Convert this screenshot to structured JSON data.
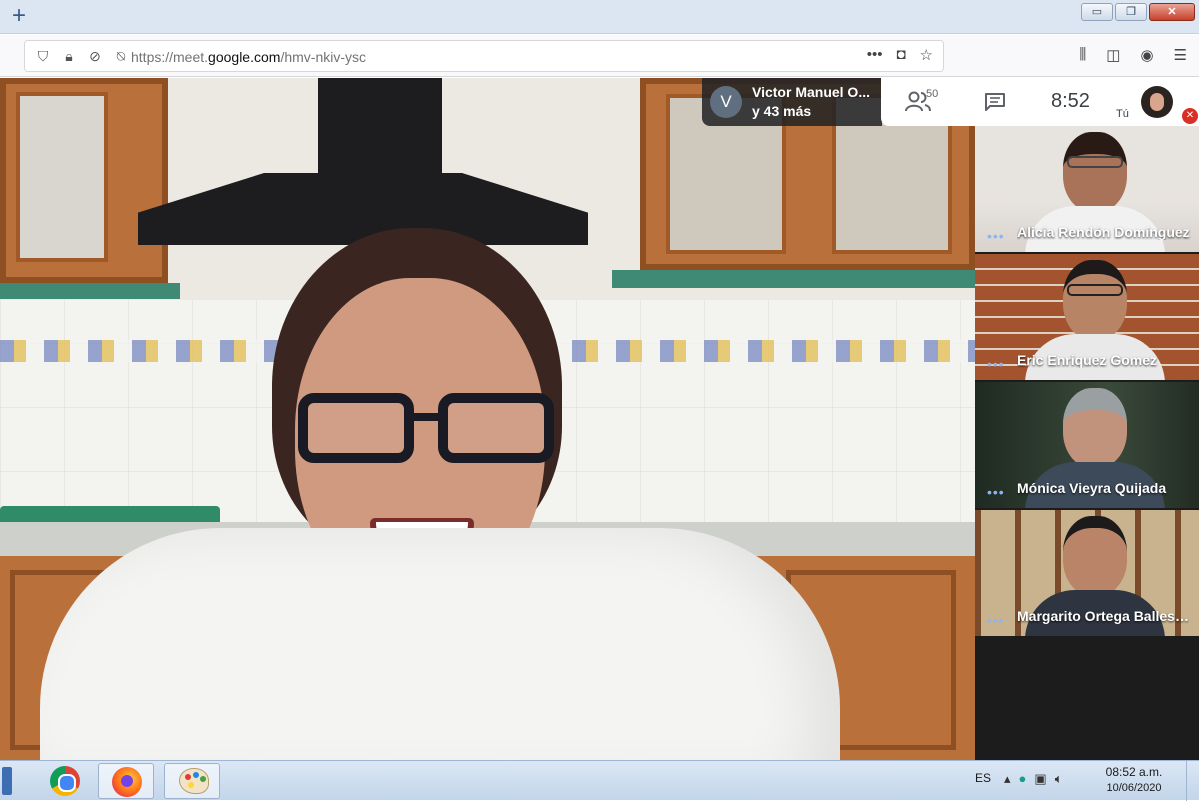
{
  "browser": {
    "new_tab_symbol": "+",
    "url_prefix": "https://meet.",
    "url_host": "google.com",
    "url_path": "/hmv-nkiv-ysc",
    "window_buttons": {
      "minimize": "▭",
      "restore": "❐",
      "close": "✕"
    }
  },
  "meet": {
    "presenter": {
      "initial": "V",
      "name": "Victor Manuel O...",
      "others": "y 43 más"
    },
    "participant_count": "50",
    "clock": "8:52",
    "self_label": "Tú",
    "participants": [
      {
        "name": "Alicia Rendón Domínguez"
      },
      {
        "name": "Eric Enriquez Gomez"
      },
      {
        "name": "Mónica Vieyra Quijada"
      },
      {
        "name": "Margarito Ortega Ballester..."
      }
    ],
    "tile_dots": "•••"
  },
  "taskbar": {
    "language": "ES",
    "time": "08:52 a.m.",
    "date": "10/06/2020"
  },
  "colors": {
    "meet_accent": "#8ab4f8",
    "mute_red": "#d93025",
    "taskbar": "#c3d5ea"
  },
  "icons": [
    "shield-icon",
    "lock-icon",
    "camera-blocked-icon",
    "mic-blocked-icon",
    "more-icon",
    "pocket-icon",
    "star-icon",
    "library-icon",
    "sidebar-icon",
    "account-icon",
    "menu-icon",
    "people-icon",
    "chat-icon",
    "mic-off-icon"
  ]
}
